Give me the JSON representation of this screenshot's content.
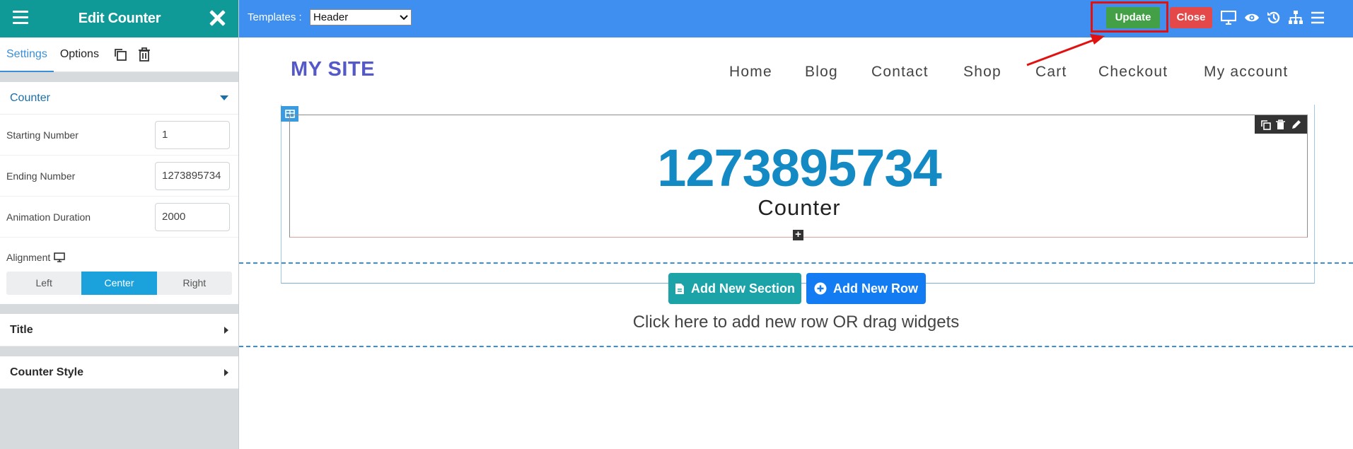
{
  "panel": {
    "title": "Edit Counter",
    "tabs": [
      {
        "label": "Settings",
        "active": true
      },
      {
        "label": "Options",
        "active": false
      }
    ],
    "counter_section": {
      "label": "Counter",
      "fields": [
        {
          "label": "Starting Number",
          "value": "1"
        },
        {
          "label": "Ending Number",
          "value": "1273895734"
        },
        {
          "label": "Animation Duration",
          "value": "2000"
        }
      ],
      "alignment": {
        "label": "Alignment",
        "options": [
          "Left",
          "Center",
          "Right"
        ],
        "selected": "Center"
      }
    },
    "collapsed_sections": [
      {
        "label": "Title"
      },
      {
        "label": "Counter Style"
      }
    ]
  },
  "topbar": {
    "templates_label": "Templates :",
    "templates_selected": "Header",
    "update_label": "Update",
    "close_label": "Close",
    "icons": [
      "desktop-icon",
      "eye-icon",
      "history-icon",
      "sitemap-icon",
      "menu-icon"
    ]
  },
  "site": {
    "logo": "MY SITE",
    "nav": [
      "Home",
      "Blog",
      "Contact",
      "Shop",
      "Cart",
      "Checkout",
      "My account"
    ]
  },
  "counter_widget": {
    "number": "1273895734",
    "title": "Counter"
  },
  "dropzone": {
    "add_section_label": "Add New Section",
    "add_row_label": "Add New Row",
    "hint": "Click here to add new row OR drag widgets"
  },
  "colors": {
    "panel_header": "#109a97",
    "topbar": "#3f8ff0",
    "update": "#43a047",
    "close": "#e54848",
    "counter_number": "#138ac4",
    "logo": "#5558c8",
    "annotation": "#e21111"
  }
}
